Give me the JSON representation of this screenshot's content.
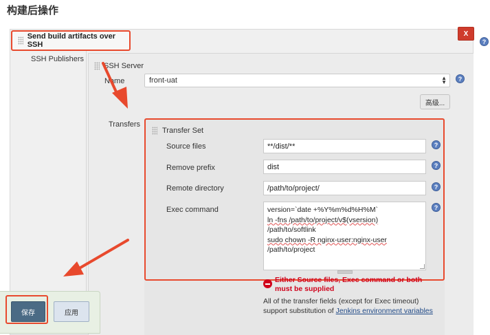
{
  "page_title": "构建后操作",
  "header": {
    "label": "Send build artifacts over SSH",
    "delete_label": "X"
  },
  "publishers": {
    "label": "SSH Publishers",
    "ssh_server_label": "SSH Server",
    "name_label": "Name",
    "name_value": "front-uat",
    "advanced_button": "高级...",
    "transfers_label": "Transfers",
    "transfer_set": {
      "title": "Transfer Set",
      "source_files_label": "Source files",
      "source_files_value": "**/dist/**",
      "remove_prefix_label": "Remove prefix",
      "remove_prefix_value": "dist",
      "remote_directory_label": "Remote directory",
      "remote_directory_value": "/path/to/project/",
      "exec_command_label": "Exec command",
      "exec_lines": [
        "version=`date +%Y%m%d%H%M`",
        "ln -fns /path/to/project/v$(vsersion)",
        "/path/to/softlink",
        "sudo chown -R nginx-user:nginx-user",
        "/path/to/project"
      ]
    },
    "error_text": "Either Source files, Exec command or both must be supplied",
    "info_text": "All of the transfer fields (except for Exec timeout) support substitution of ",
    "info_link": "Jenkins environment variables"
  },
  "help_glyph": "?",
  "buttons": {
    "save": "保存",
    "apply": "应用"
  },
  "colors": {
    "highlight": "#e8492d",
    "error": "#d0021b",
    "save_button": "#4b6b85",
    "link": "#204a87"
  },
  "icons": [
    "grip-icon",
    "help-icon",
    "close-icon",
    "error-icon",
    "dropdown-arrow-icon",
    "annotation-arrow"
  ]
}
